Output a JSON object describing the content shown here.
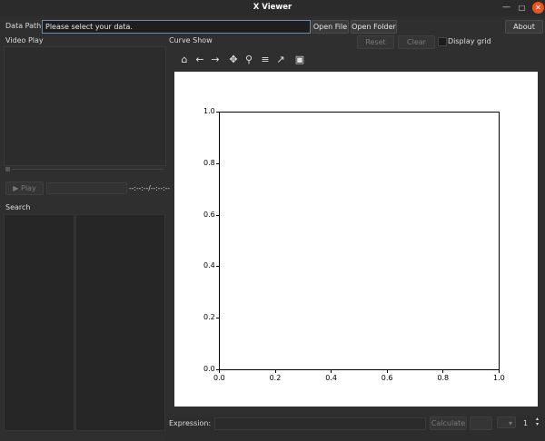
{
  "window": {
    "title": "X Viewer",
    "min_icon": "—",
    "max_icon": "□",
    "close_icon": "✕"
  },
  "topbar": {
    "data_path_label": "Data Path:",
    "data_path_value": "Please select your data.",
    "open_file": "Open File",
    "open_folder": "Open Folder",
    "about": "About"
  },
  "video": {
    "title": "Video Play",
    "play": "▶ Play",
    "time": "--:--:--/--:--:--"
  },
  "search": {
    "title": "Search"
  },
  "curve": {
    "title": "Curve Show",
    "reset": "Reset",
    "clear": "Clear",
    "display_grid": "Display grid",
    "display_grid_checked": false,
    "toolbar": [
      {
        "name": "home-icon",
        "glyph": "⌂"
      },
      {
        "name": "back-icon",
        "glyph": "←"
      },
      {
        "name": "forward-icon",
        "glyph": "→"
      },
      {
        "name": "pan-icon",
        "glyph": "✥"
      },
      {
        "name": "zoom-icon",
        "glyph": "⚲"
      },
      {
        "name": "configure-subplots-icon",
        "glyph": "≡"
      },
      {
        "name": "edit-axis-icon",
        "glyph": "↗"
      },
      {
        "name": "save-icon",
        "glyph": "▣"
      }
    ]
  },
  "bottom": {
    "expression_label": "Expression:",
    "calculate": "Calculate",
    "spin_value": "1"
  },
  "chart_data": {
    "type": "line",
    "title": "",
    "xlabel": "",
    "ylabel": "",
    "xlim": [
      0.0,
      1.0
    ],
    "ylim": [
      0.0,
      1.0
    ],
    "x_ticks": [
      "0.0",
      "0.2",
      "0.4",
      "0.6",
      "0.8",
      "1.0"
    ],
    "y_ticks": [
      "0.0",
      "0.2",
      "0.4",
      "0.6",
      "0.8",
      "1.0"
    ],
    "series": [],
    "grid": false
  }
}
